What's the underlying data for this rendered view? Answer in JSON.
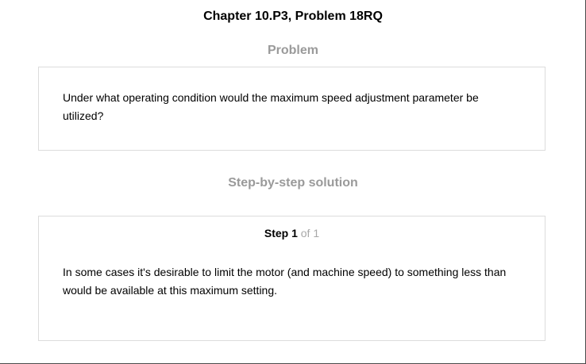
{
  "header": {
    "title": "Chapter 10.P3, Problem 18RQ"
  },
  "problem": {
    "heading": "Problem",
    "text": "Under what operating condition would the maximum speed adjustment parameter be utilized?"
  },
  "solution": {
    "heading": "Step-by-step solution",
    "step_word": "Step 1",
    "step_of": "of 1",
    "text": "In some cases it's desirable to limit the motor (and machine speed) to something less than would be available at this maximum setting."
  }
}
